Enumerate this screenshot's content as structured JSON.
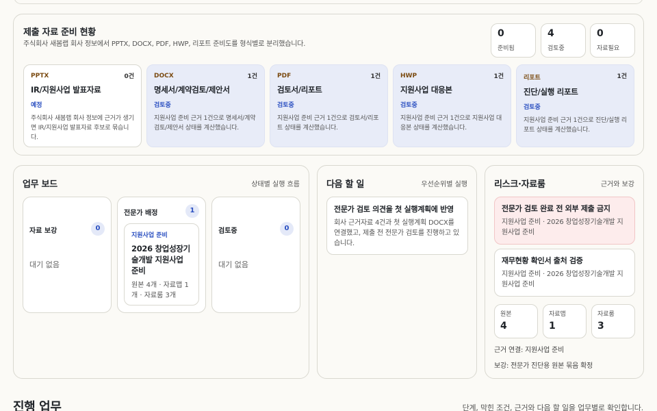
{
  "prep": {
    "title": "제출 자료 준비 현황",
    "desc": "주식회사 새봄랩 회사 정보에서 PPTX, DOCX, PDF, HWP, 리포트 준비도를 형식별로 분리했습니다.",
    "stats": [
      {
        "value": "0",
        "label": "준비됨"
      },
      {
        "value": "4",
        "label": "검토중"
      },
      {
        "value": "0",
        "label": "자료필요"
      }
    ],
    "formats": [
      {
        "name": "PPTX",
        "count": "0건",
        "title": "IR/지원사업 발표자료",
        "status": "예정",
        "desc": "주식회사 새봄랩 회사 정보에 근거가 생기면 IR/지원사업 발표자료 후보로 묶습니다."
      },
      {
        "name": "DOCX",
        "count": "1건",
        "title": "명세서/계약검토/제안서",
        "status": "검토중",
        "desc": "지원사업 준비 근거 1건으로 명세서/계약검토/제안서 상태를 계산했습니다."
      },
      {
        "name": "PDF",
        "count": "1건",
        "title": "검토서/리포트",
        "status": "검토중",
        "desc": "지원사업 준비 근거 1건으로 검토서/리포트 상태를 계산했습니다."
      },
      {
        "name": "HWP",
        "count": "1건",
        "title": "지원사업 대응본",
        "status": "검토중",
        "desc": "지원사업 준비 근거 1건으로 지원사업 대응본 상태를 계산했습니다."
      },
      {
        "name": "리포트",
        "count": "1건",
        "title": "진단/실행 리포트",
        "status": "검토중",
        "desc": "지원사업 준비 근거 1건으로 진단/실행 리포트 상태를 계산했습니다."
      }
    ]
  },
  "board": {
    "title": "업무 보드",
    "side": "상태별 실행 흐름",
    "columns": [
      {
        "label": "자료 보강",
        "count": "0",
        "empty": "대기 없음"
      },
      {
        "label": "전문가 배정",
        "count": "1",
        "card": {
          "tag": "지원사업 준비",
          "title": "2026 창업성장기술개발 지원사업 준비",
          "meta": "원본 4개 · 자료맵 1개 · 자료룸 3개"
        }
      },
      {
        "label": "검토중",
        "count": "0",
        "empty": "대기 없음"
      }
    ]
  },
  "next": {
    "title": "다음 할 일",
    "side": "우선순위별 실행",
    "card": {
      "title": "전문가 검토 의견을 첫 실행계획에 반영",
      "desc": "회사 근거자료 4건과 첫 실행계획 DOCX를 연결했고, 제출 전 전문가 검토를 진행하고 있습니다."
    }
  },
  "risk": {
    "title": "리스크·자료룸",
    "side": "근거와 보강",
    "cards": [
      {
        "title": "전문가 검토 완료 전 외부 제출 금지",
        "desc": "지원사업 준비 · 2026 창업성장기술개발 지원사업 준비"
      },
      {
        "title": "재무현황 확인서 출처 검증",
        "desc": "지원사업 준비 · 2026 창업성장기술개발 지원사업 준비"
      }
    ],
    "counts": [
      {
        "label": "원본",
        "value": "4"
      },
      {
        "label": "자료맵",
        "value": "1"
      },
      {
        "label": "자료룸",
        "value": "3"
      }
    ],
    "link": "근거 연결: 지원사업 준비",
    "supplement": "보강: 전문가 진단용 원본 묶음 확정"
  },
  "progress": {
    "title": "진행 업무",
    "desc": "단계, 막힌 조건, 근거와 다음 할 일을 업무별로 확인합니다."
  }
}
